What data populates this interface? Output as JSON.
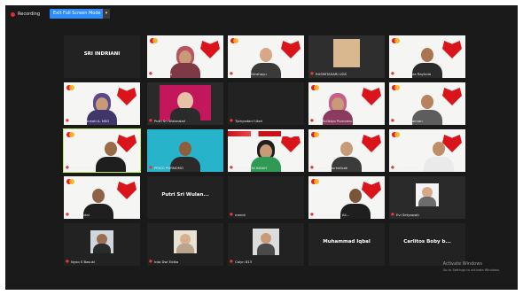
{
  "toolbar": {
    "recording_label": "Recording",
    "view_button_label": "Exit Full Screen Mode",
    "dropdown_caret": "▾"
  },
  "tiles": [
    {
      "caption": "SRI INDRIANI"
    },
    {
      "caption": "Heny Sulia"
    },
    {
      "caption": "Sepriska Srirahayu"
    },
    {
      "caption": "RUSMITASARI UGS"
    },
    {
      "caption": "Dagas Tiara Rayinda"
    },
    {
      "caption": "Pelsa Sujarwati A. NSG"
    },
    {
      "caption": "Putri Sri Wulandari"
    },
    {
      "caption": "Tjahyadani Utari"
    },
    {
      "caption": "Arif Sulistyo Purnomo"
    },
    {
      "caption": "Lucky Sulaiman"
    },
    {
      "caption": "Priska Rizkita"
    },
    {
      "caption": "PRIGO PURNOMO"
    },
    {
      "caption": "ANGGRAENI INDAH"
    },
    {
      "caption": "Maulani Nurhalizah"
    },
    {
      "caption": "Lutfi Kusuma"
    },
    {
      "caption": "Ujoko Ikdal"
    },
    {
      "caption": "Putri Sri Wulan..."
    },
    {
      "caption": "mendi"
    },
    {
      "caption": "Jatmil Inuakbar Ali..."
    },
    {
      "caption": "Evi Setyawati"
    },
    {
      "caption": "Nyoo S Basuki"
    },
    {
      "caption": "Irda Dwi Edika"
    },
    {
      "caption": "Calyn 813"
    },
    {
      "caption": "Muhammad Iqbal"
    },
    {
      "caption": "Carlitos Boby b..."
    }
  ],
  "center_names": {
    "tile0": "SRI INDRIANI",
    "tile16": "Putri Sri Wulan...",
    "tile23": "Muhammad Iqbal",
    "tile24": "Carlitos Boby b..."
  },
  "watermark": {
    "title": "Activate Windows",
    "subtitle": "Go to Settings to activate Windows."
  },
  "colors": {
    "background": "#1a1a1a",
    "accent": "#2d8cff",
    "active_speaker": "#b7f24a",
    "brand_red": "#d9141b"
  }
}
